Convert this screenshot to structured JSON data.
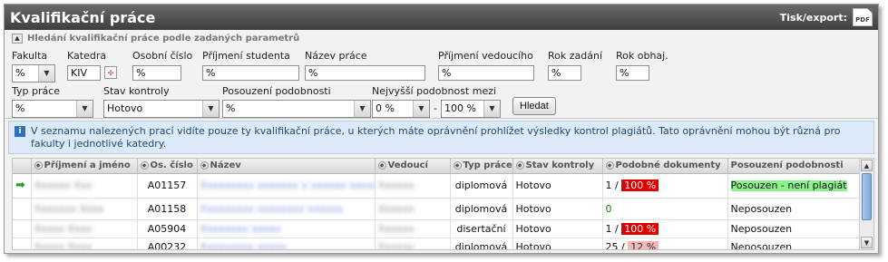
{
  "header": {
    "title": "Kvalifikační práce",
    "export_label": "Tisk/export:",
    "pdf_label": "PDF"
  },
  "search": {
    "toggle_label": "Hledání kvalifikační práce podle zadaných parametrů",
    "fakulta": {
      "label": "Fakulta",
      "value": "%"
    },
    "katedra": {
      "label": "Katedra",
      "value": "KIV"
    },
    "osobni_cislo": {
      "label": "Osobní číslo",
      "value": "%"
    },
    "prijmeni_studenta": {
      "label": "Příjmení studenta",
      "value": "%"
    },
    "nazev_prace": {
      "label": "Název práce",
      "value": "%"
    },
    "prijmeni_vedouciho": {
      "label": "Příjmení vedoucího",
      "value": "%"
    },
    "rok_zadani": {
      "label": "Rok zadání",
      "value": "%"
    },
    "rok_obhaj": {
      "label": "Rok obhaj.",
      "value": "%"
    },
    "typ_prace": {
      "label": "Typ práce",
      "value": "%"
    },
    "stav_kontroly": {
      "label": "Stav kontroly",
      "value": "Hotovo"
    },
    "posouzeni_podobnosti": {
      "label": "Posouzení podobnosti",
      "value": "%"
    },
    "nejvyssi_podobnost": {
      "label": "Nejvyšší podobnost mezi",
      "from": "0 %",
      "separator": "-",
      "to": "100 %"
    },
    "submit_label": "Hledat"
  },
  "info_text": "V seznamu nalezených prací vidíte pouze ty kvalifikační práce, u kterých máte oprávnění prohlížet výsledky kontrol plagiátů. Tato oprávnění mohou být různá pro fakulty i jednotlivé katedry.",
  "table": {
    "columns": [
      "Příjmení a jméno",
      "Os. číslo",
      "Název",
      "Vedoucí",
      "Typ práce",
      "Stav kontroly",
      "Podobné dokumenty",
      "Posouzení podobnosti"
    ],
    "rows": [
      {
        "osobni_cislo": "A01157",
        "typ": "diplomová",
        "stav": "Hotovo",
        "podobne_count": "1 /",
        "podobne_pct": "100 %",
        "posouzeni": "Posouzen - není plagiát",
        "selected": true
      },
      {
        "osobni_cislo": "A01158",
        "typ": "diplomová",
        "stav": "Hotovo",
        "podobne_count": "0",
        "podobne_pct": "",
        "posouzeni": "Neposouzen",
        "selected": false
      },
      {
        "osobni_cislo": "A05904",
        "typ": "disertační",
        "stav": "Hotovo",
        "podobne_count": "1 /",
        "podobne_pct": "100 %",
        "posouzeni": "Neposouzen",
        "selected": false
      },
      {
        "osobni_cislo": "A00232",
        "typ": "diplomová",
        "stav": "Hotovo",
        "podobne_count": "25 /",
        "podobne_pct": "12 %",
        "posouzeni": "Neposouzen",
        "selected": false
      }
    ]
  },
  "colors": {
    "title_bar": "#4e4e4e",
    "info_bg": "#dbe9f8",
    "pct_high": "#e00000",
    "posouzen_bg": "#8ef08e",
    "zero_green": "#0a8a0a"
  }
}
